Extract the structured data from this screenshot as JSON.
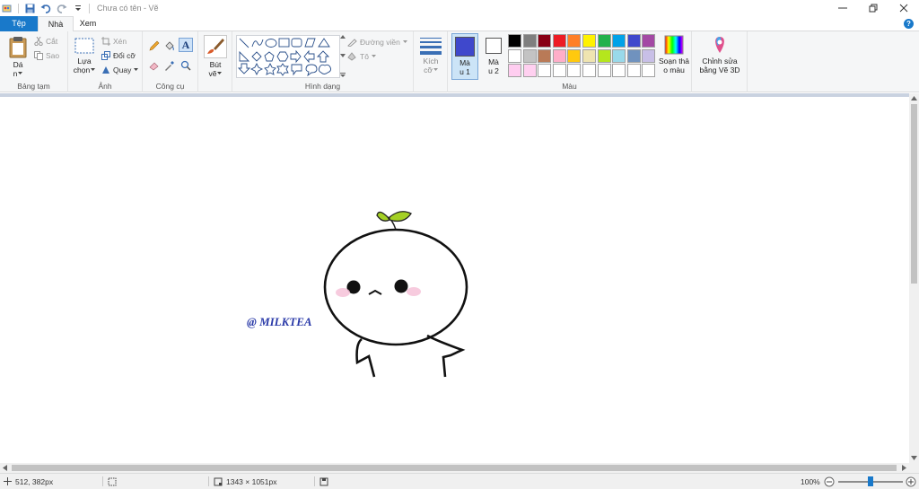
{
  "window": {
    "title": "Chưa có tên - Vẽ",
    "controls": [
      "minimize",
      "restore",
      "close"
    ]
  },
  "tabs": [
    {
      "label": "Tệp"
    },
    {
      "label": "Nhà"
    },
    {
      "label": "Xem"
    }
  ],
  "ribbon": {
    "clipboard": {
      "label": "Bảng tạm",
      "paste_line1": "Dá",
      "paste_line2": "n",
      "cut": "Cắt",
      "copy": "Sao"
    },
    "image": {
      "label": "Ảnh",
      "select_line1": "Lựa",
      "select_line2": "chọn",
      "crop": "Xén",
      "resize": "Đổi cỡ",
      "rotate": "Quay"
    },
    "tools": {
      "label": "Công cụ"
    },
    "brushes": {
      "label_line1": "Bút",
      "label_line2": "vẽ"
    },
    "shapes": {
      "label": "Hình dạng",
      "outline": "Đường viền",
      "fill": "Tô"
    },
    "size": {
      "label_line1": "Kích",
      "label_line2": "cỡ"
    },
    "colors": {
      "label": "Màu",
      "color1_line1": "Mà",
      "color1_line2": "u 1",
      "color2_line1": "Mà",
      "color2_line2": "u 2",
      "color1_value": "#3f48cc",
      "color2_value": "#ffffff",
      "edit_line1": "Soạn thả",
      "edit_line2": "o màu",
      "palette_row1": [
        "#000000",
        "#7f7f7f",
        "#880015",
        "#ed1c24",
        "#ff7f27",
        "#fff200",
        "#22b14c",
        "#00a2e8",
        "#3f48cc",
        "#a349a4"
      ],
      "palette_row2": [
        "#ffffff",
        "#c3c3c3",
        "#b97a57",
        "#ffaec9",
        "#ffc90e",
        "#efe4b0",
        "#b5e61d",
        "#99d9ea",
        "#7092be",
        "#c8bfe7"
      ],
      "palette_row3": [
        "#ffcdf0",
        "#ffd0f0",
        "#ffffff",
        "#ffffff",
        "#ffffff",
        "#ffffff",
        "#ffffff",
        "#ffffff",
        "#ffffff",
        "#ffffff"
      ]
    },
    "paint3d": {
      "line1": "Chỉnh sửa",
      "line2": "bằng Vẽ 3D"
    }
  },
  "canvas": {
    "watermark_text": "@ MILKTEA"
  },
  "status": {
    "cursor_pos": "512, 382px",
    "canvas_size": "1343 × 1051px",
    "zoom": "100%",
    "zoom_level": 0.5
  }
}
